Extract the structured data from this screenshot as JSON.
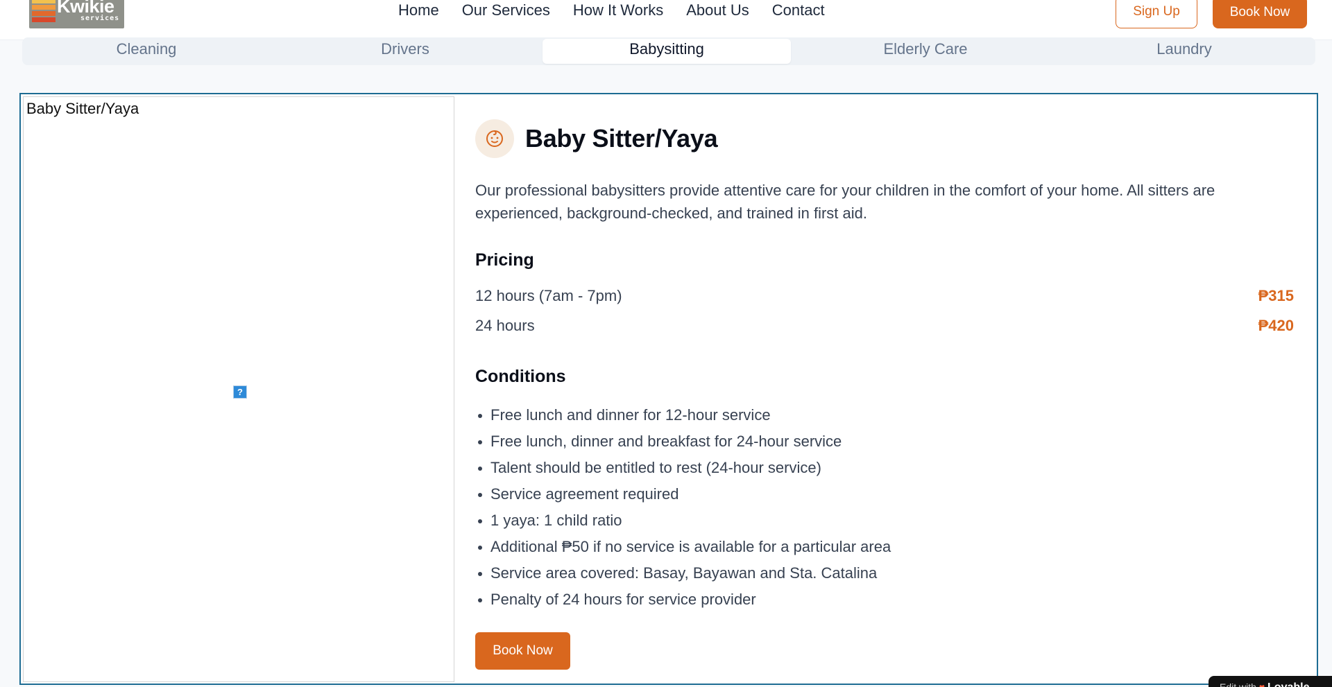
{
  "header": {
    "logo": {
      "brand": "Kwikie",
      "tagline": "services"
    },
    "nav": [
      "Home",
      "Our Services",
      "How It Works",
      "About Us",
      "Contact"
    ],
    "signup_label": "Sign Up",
    "booknow_label": "Book Now"
  },
  "tabs": [
    "Cleaning",
    "Drivers",
    "Babysitting",
    "Elderly Care",
    "Laundry"
  ],
  "active_tab": "Babysitting",
  "service": {
    "image_alt": "Baby Sitter/Yaya",
    "icon": "baby-face-icon",
    "title": "Baby Sitter/Yaya",
    "description": "Our professional babysitters provide attentive care for your children in the comfort of your home. All sitters are experienced, background-checked, and trained in first aid.",
    "pricing_heading": "Pricing",
    "pricing": [
      {
        "label": "12 hours (7am - 7pm)",
        "price": "₱315"
      },
      {
        "label": "24 hours",
        "price": "₱420"
      }
    ],
    "conditions_heading": "Conditions",
    "conditions": [
      "Free lunch and dinner for 12-hour service",
      "Free lunch, dinner and breakfast for 24-hour service",
      "Talent should be entitled to rest (24-hour service)",
      "Service agreement required",
      "1 yaya: 1 child ratio",
      "Additional ₱50 if no service is available for a particular area",
      "Service area covered: Basay, Bayawan and Sta. Catalina",
      "Penalty of 24 hours for service provider"
    ],
    "book_label": "Book Now"
  },
  "badge": {
    "prefix": "Edit with",
    "brand": "Lovable"
  },
  "colors": {
    "accent": "#d9671e",
    "card_border": "#1d6c93",
    "tab_bg": "#eef2f6"
  }
}
